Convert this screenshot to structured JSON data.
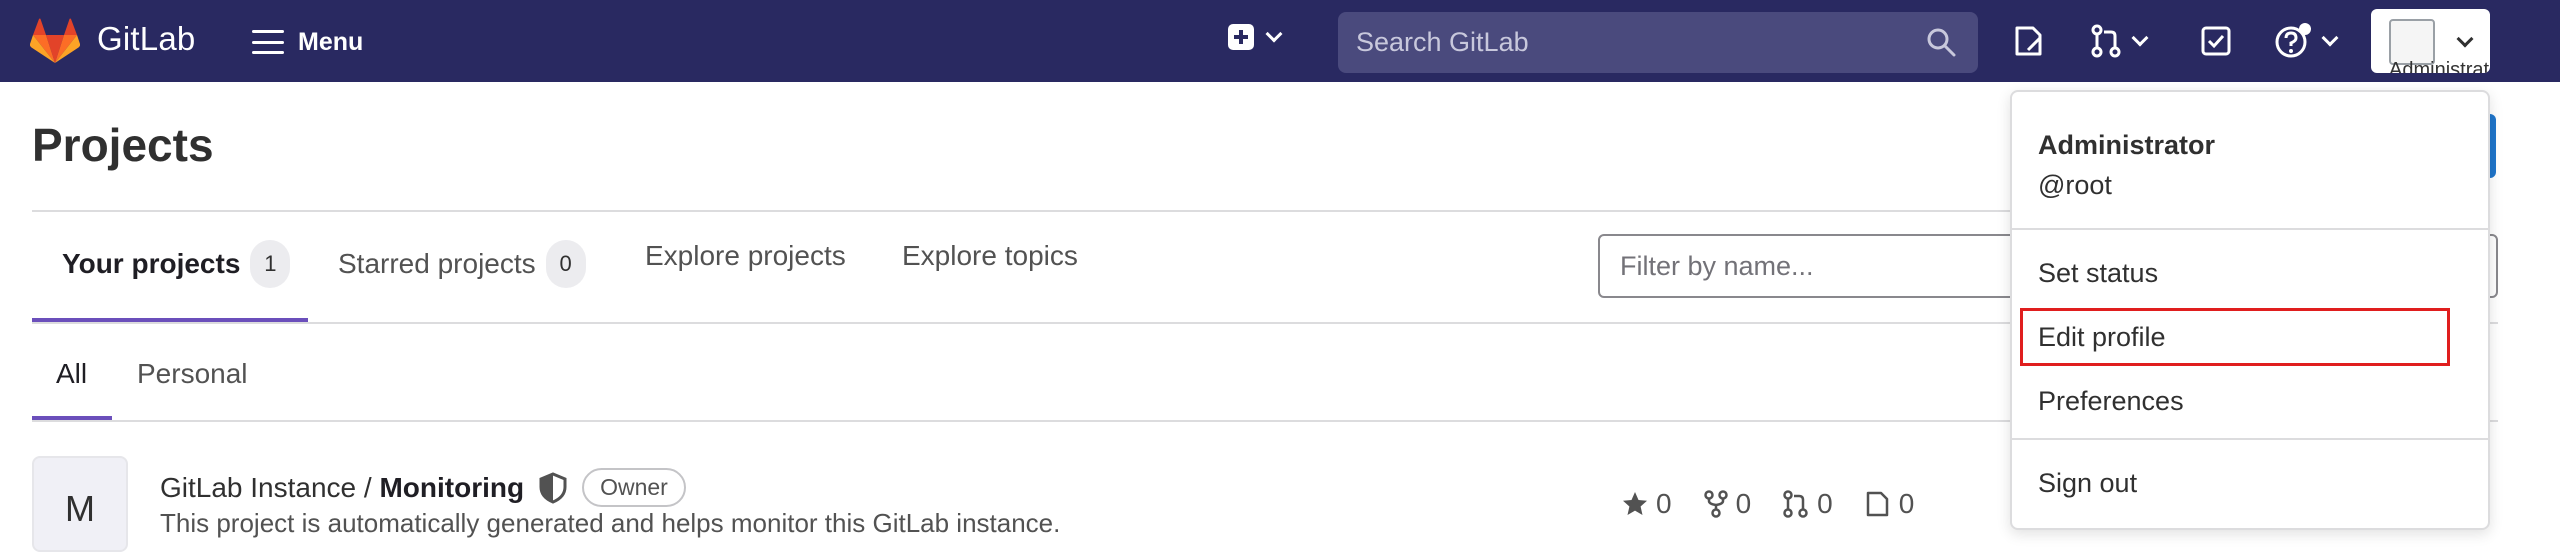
{
  "navbar": {
    "brand": "GitLab",
    "menu_label": "Menu",
    "search_placeholder": "Search GitLab",
    "avatar_alt": "Administrator",
    "colors": {
      "background": "#292961",
      "search_bg": "#4a4a7d",
      "logo": "#fc6d26"
    }
  },
  "page": {
    "title": "Projects",
    "tabs": [
      {
        "label": "Your projects",
        "count": "1"
      },
      {
        "label": "Starred projects",
        "count": "0"
      },
      {
        "label": "Explore projects"
      },
      {
        "label": "Explore topics"
      }
    ],
    "filter_placeholder": "Filter by name...",
    "sub_tabs": [
      "All",
      "Personal"
    ]
  },
  "project": {
    "avatar_letter": "M",
    "namespace": "GitLab Instance / ",
    "name": "Monitoring",
    "role": "Owner",
    "description": "This project is automatically generated and helps monitor this GitLab instance.",
    "stats": {
      "stars": "0",
      "forks": "0",
      "merge_requests": "0",
      "issues": "0"
    }
  },
  "user_dropdown": {
    "name": "Administrator",
    "username": "@root",
    "items": [
      "Set status",
      "Edit profile",
      "Preferences",
      "Sign out"
    ],
    "highlight_color": "#e01e1e"
  }
}
